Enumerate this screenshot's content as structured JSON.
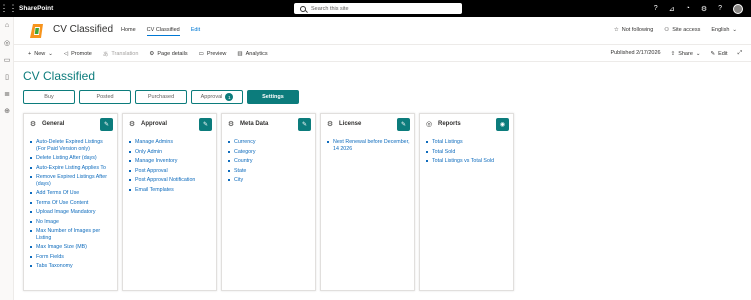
{
  "suite": {
    "brand": "SharePoint",
    "search_placeholder": "Search this site"
  },
  "appbar": [
    "home-icon",
    "globe-icon",
    "chat-icon",
    "document-icon",
    "list-icon",
    "add-icon"
  ],
  "site": {
    "title": "CV Classified",
    "nav": [
      "Home",
      "CV Classified"
    ],
    "nav_edit": "Edit",
    "following": "Not following",
    "site_access": "Site access",
    "language": "English"
  },
  "commandbar": {
    "new": "New",
    "promote": "Promote",
    "translation": "Translation",
    "page_details": "Page details",
    "preview": "Preview",
    "analytics": "Analytics",
    "published": "Published 2/17/2026",
    "share": "Share",
    "edit": "Edit"
  },
  "page": {
    "title": "CV Classified",
    "tabs": [
      {
        "label": "Buy"
      },
      {
        "label": "Posted"
      },
      {
        "label": "Purchased"
      },
      {
        "label": "Approval",
        "badge": "1"
      },
      {
        "label": "Settings"
      }
    ]
  },
  "cards": [
    {
      "title": "General",
      "icon": "gear-icon",
      "items": [
        "Auto-Delete Expired Listings (For Paid Version only)",
        "Delete Listing After (days)",
        "Auto-Expire Listing Applies To",
        "Remove Expired Listings After (days)",
        "Add Terms Of Use",
        "Terms Of Use Content",
        "Upload Image Mandatory",
        "No Image",
        "Max Number of Images per Listing",
        "Max Image Size (MB)",
        "Form Fields",
        "Tabs Taxonomy"
      ]
    },
    {
      "title": "Approval",
      "icon": "gear-icon",
      "items": [
        "Manage Admins",
        "Only Admin",
        "Manage Inventory",
        "Post Approval",
        "Post Approval Notification",
        "Email Templates"
      ]
    },
    {
      "title": "Meta Data",
      "icon": "gear-icon",
      "items": [
        "Currency",
        "Category",
        "Country",
        "State",
        "City"
      ]
    },
    {
      "title": "License",
      "icon": "gear-icon",
      "items": [
        "Next Renewal before December, 14 2026"
      ]
    },
    {
      "title": "Reports",
      "icon": "report-icon",
      "items": [
        "Total Listings",
        "Total Sold",
        "Total Listings vs Total Sold"
      ]
    }
  ],
  "colors": {
    "accent": "#0c7c7c",
    "link": "#0f6cbd",
    "suitebar": "#000000"
  }
}
